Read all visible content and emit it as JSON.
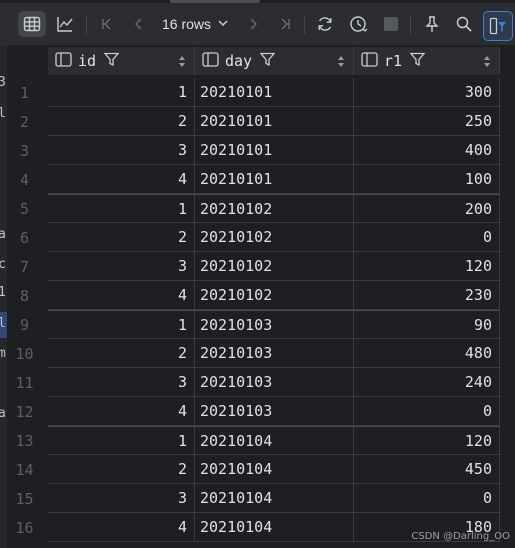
{
  "toolbar": {
    "rows_label": "16 rows",
    "icons": [
      "table-view-icon",
      "chart-view-icon",
      "first-page-icon",
      "prev-page-icon",
      "rows-dropdown-icon",
      "next-page-icon",
      "last-page-icon",
      "refresh-icon",
      "history-icon",
      "stop-icon",
      "pin-icon",
      "search-icon",
      "filter-icon"
    ]
  },
  "columns": [
    {
      "name": "id"
    },
    {
      "name": "day"
    },
    {
      "name": "r1"
    }
  ],
  "rows": [
    {
      "n": "1",
      "id": "1",
      "day": "20210101",
      "r1": "300"
    },
    {
      "n": "2",
      "id": "2",
      "day": "20210101",
      "r1": "250"
    },
    {
      "n": "3",
      "id": "3",
      "day": "20210101",
      "r1": "400"
    },
    {
      "n": "4",
      "id": "4",
      "day": "20210101",
      "r1": "100"
    },
    {
      "n": "5",
      "id": "1",
      "day": "20210102",
      "r1": "200"
    },
    {
      "n": "6",
      "id": "2",
      "day": "20210102",
      "r1": "0"
    },
    {
      "n": "7",
      "id": "3",
      "day": "20210102",
      "r1": "120"
    },
    {
      "n": "8",
      "id": "4",
      "day": "20210102",
      "r1": "230"
    },
    {
      "n": "9",
      "id": "1",
      "day": "20210103",
      "r1": "90"
    },
    {
      "n": "10",
      "id": "2",
      "day": "20210103",
      "r1": "480"
    },
    {
      "n": "11",
      "id": "3",
      "day": "20210103",
      "r1": "240"
    },
    {
      "n": "12",
      "id": "4",
      "day": "20210103",
      "r1": "0"
    },
    {
      "n": "13",
      "id": "1",
      "day": "20210104",
      "r1": "120"
    },
    {
      "n": "14",
      "id": "2",
      "day": "20210104",
      "r1": "450"
    },
    {
      "n": "15",
      "id": "3",
      "day": "20210104",
      "r1": "0"
    },
    {
      "n": "16",
      "id": "4",
      "day": "20210104",
      "r1": "180"
    }
  ],
  "left_strip_chars": [
    {
      "ch": "3"
    },
    {
      "ch": "l"
    },
    {
      "ch": "a"
    },
    {
      "ch": "c"
    },
    {
      "ch": "1"
    },
    {
      "ch": "l"
    },
    {
      "ch": "m"
    },
    {
      "ch": "a"
    }
  ],
  "watermark": "CSDN @Darling_OO",
  "colors": {
    "background": "#1e1f22",
    "toolbar": "#2b2d30",
    "accent": "#3f7dd6",
    "text": "#dfe1e5",
    "row_number": "#5c5f66"
  }
}
